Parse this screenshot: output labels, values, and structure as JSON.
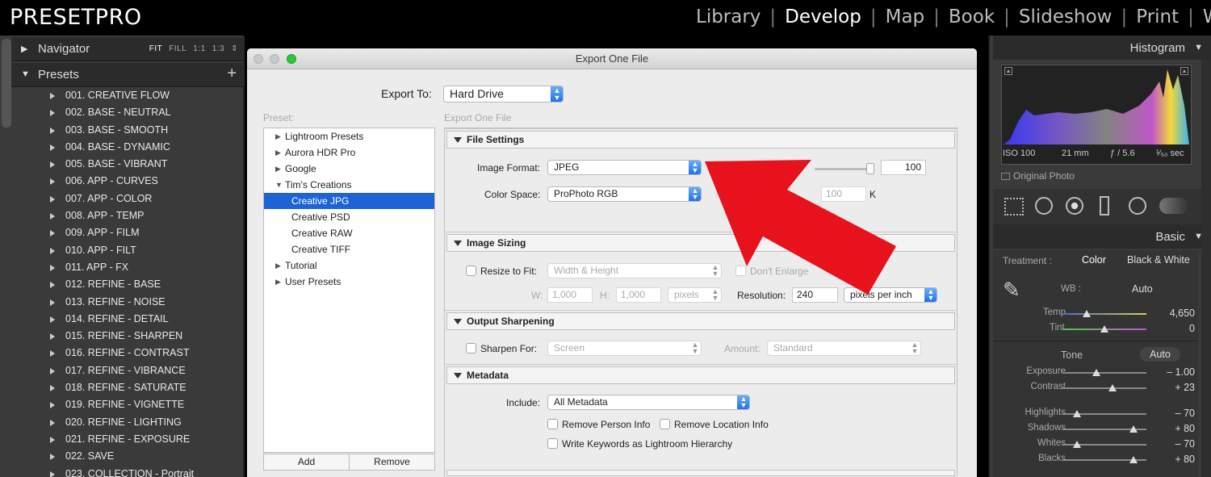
{
  "brand": "PRESETPRO",
  "modules": {
    "library": "Library",
    "develop": "Develop",
    "map": "Map",
    "book": "Book",
    "slideshow": "Slideshow",
    "print": "Print",
    "web": "Web"
  },
  "left_panel": {
    "navigator_label": "Navigator",
    "nav_options": [
      "FIT",
      "FILL",
      "1:1",
      "1:3"
    ],
    "presets_label": "Presets",
    "add_symbol": "+",
    "presets": [
      "001. CREATIVE FLOW",
      "002. BASE - NEUTRAL",
      "003. BASE - SMOOTH",
      "004. BASE - DYNAMIC",
      "005. BASE - VIBRANT",
      "006. APP - CURVES",
      "007. APP - COLOR",
      "008. APP - TEMP",
      "009. APP - FILM",
      "010. APP - FILT",
      "011. APP - FX",
      "012. REFINE - BASE",
      "013. REFINE - NOISE",
      "014. REFINE - DETAIL",
      "015. REFINE - SHARPEN",
      "016. REFINE - CONTRAST",
      "017. REFINE - VIBRANCE",
      "018. REFINE - SATURATE",
      "019. REFINE - VIGNETTE",
      "020. REFINE - LIGHTING",
      "021. REFINE - EXPOSURE",
      "022. SAVE",
      "023. COLLECTION - Portrait"
    ]
  },
  "dialog": {
    "title": "Export One File",
    "export_to_label": "Export To:",
    "export_to_value": "Hard Drive",
    "preset_label": "Preset:",
    "settings_label": "Export One File",
    "tree": [
      {
        "label": "Lightroom Presets",
        "arrow": "▶"
      },
      {
        "label": "Aurora HDR Pro",
        "arrow": "▶"
      },
      {
        "label": "Google",
        "arrow": "▶"
      },
      {
        "label": "Tim's Creations",
        "arrow": "▼"
      },
      {
        "label": "Creative JPG",
        "arrow": ""
      },
      {
        "label": "Creative PSD",
        "arrow": ""
      },
      {
        "label": "Creative RAW",
        "arrow": ""
      },
      {
        "label": "Creative TIFF",
        "arrow": ""
      },
      {
        "label": "Tutorial",
        "arrow": "▶"
      },
      {
        "label": "User Presets",
        "arrow": "▶"
      }
    ],
    "add_button": "Add",
    "remove_button": "Remove",
    "file_settings": {
      "header": "File Settings",
      "image_format_label": "Image Format:",
      "image_format_value": "JPEG",
      "quality_value": "100",
      "color_space_label": "Color Space:",
      "color_space_value": "ProPhoto RGB",
      "limit_value": "100",
      "limit_unit": "K"
    },
    "image_sizing": {
      "header": "Image Sizing",
      "resize_label": "Resize to Fit:",
      "resize_value": "Width & Height",
      "dont_enlarge": "Don't Enlarge",
      "w_label": "W:",
      "w_value": "1,000",
      "h_label": "H:",
      "h_value": "1,000",
      "units_value": "pixels",
      "resolution_label": "Resolution:",
      "resolution_value": "240",
      "resolution_units": "pixels per inch"
    },
    "output_sharpening": {
      "header": "Output Sharpening",
      "sharpen_label": "Sharpen For:",
      "sharpen_value": "Screen",
      "amount_label": "Amount:",
      "amount_value": "Standard"
    },
    "metadata": {
      "header": "Metadata",
      "include_label": "Include:",
      "include_value": "All Metadata",
      "remove_person": "Remove Person Info",
      "remove_location": "Remove Location Info",
      "write_keywords": "Write Keywords as Lightroom Hierarchy"
    }
  },
  "right_panel": {
    "histogram_label": "Histogram",
    "iso": "ISO 100",
    "focal": "21 mm",
    "aperture": "ƒ / 5.6",
    "shutter": "¹⁄₅₀ sec",
    "original_photo": "Original Photo",
    "basic_label": "Basic",
    "treatment_label": "Treatment :",
    "treatment_color": "Color",
    "treatment_bw": "Black & White",
    "wb_label": "WB :",
    "wb_value": "Auto",
    "temp_label": "Temp",
    "temp_value": "4,650",
    "tint_label": "Tint",
    "tint_value": "0",
    "tone_label": "Tone",
    "tone_auto": "Auto",
    "exposure_label": "Exposure",
    "exposure_value": "– 1.00",
    "contrast_label": "Contrast",
    "contrast_value": "+ 23",
    "highlights_label": "Highlights",
    "highlights_value": "– 70",
    "shadows_label": "Shadows",
    "shadows_value": "+ 80",
    "whites_label": "Whites",
    "whites_value": "– 70",
    "blacks_label": "Blacks",
    "blacks_value": "+ 80"
  },
  "colors": {
    "accent_blue": "#1c64d6",
    "arrow_red": "#e8121c"
  }
}
